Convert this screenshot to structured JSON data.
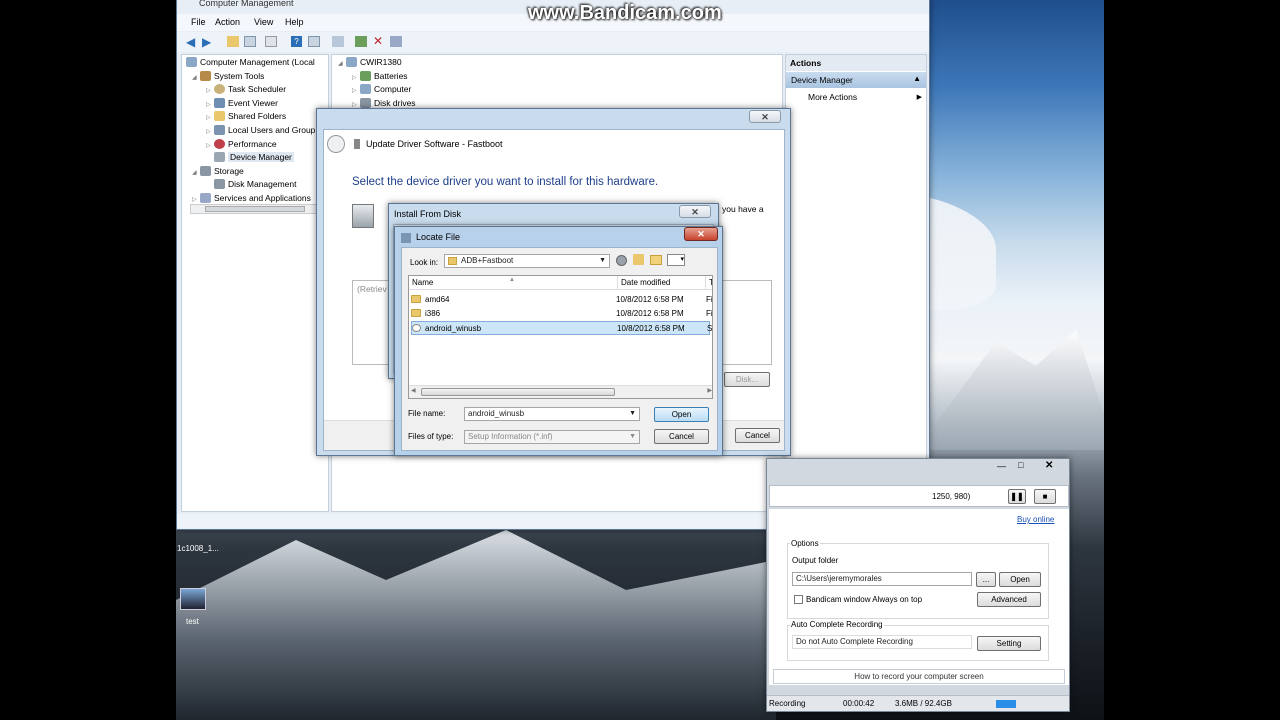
{
  "watermark": "www.Bandicam.com",
  "cm": {
    "title": "Computer Management",
    "menu": [
      "File",
      "Action",
      "View",
      "Help"
    ],
    "tree": [
      "Computer Management (Local",
      "System Tools",
      "Task Scheduler",
      "Event Viewer",
      "Shared Folders",
      "Local Users and Group",
      "Performance",
      "Device Manager",
      "Storage",
      "Disk Management",
      "Services and Applications"
    ],
    "devices": {
      "root": "CWIR1380",
      "items": [
        "Batteries",
        "Computer",
        "Disk drives"
      ]
    },
    "actions": {
      "header": "Actions",
      "section": "Device Manager",
      "more": "More Actions"
    }
  },
  "upd": {
    "title": "Update Driver Software - Fastboot",
    "heading": "Select the device driver you want to install for this hardware.",
    "partial": "you have a",
    "retrieving": "(Retriev",
    "disk_btn": "Disk...",
    "cancel": "Cancel"
  },
  "ifd": {
    "title": "Install From Disk"
  },
  "lf": {
    "title": "Locate File",
    "look_label": "Look in:",
    "look_value": "ADB+Fastboot",
    "cols": [
      "Name",
      "Date modified",
      "Ty"
    ],
    "files": [
      {
        "name": "amd64",
        "date": "10/8/2012 6:58 PM",
        "type": "Fi"
      },
      {
        "name": "i386",
        "date": "10/8/2012 6:58 PM",
        "type": "Fi"
      },
      {
        "name": "android_winusb",
        "date": "10/8/2012 6:58 PM",
        "type": "Se"
      }
    ],
    "fname_label": "File name:",
    "fname_value": "android_winusb",
    "ftype_label": "Files of type:",
    "ftype_value": "Setup Information (*.inf)",
    "open": "Open",
    "cancel": "Cancel"
  },
  "desktop": {
    "file_label": "1c1008_1...",
    "icon_label": "test"
  },
  "bc": {
    "coords": "1250, 980)",
    "buy": "Buy online",
    "options": "Options",
    "out_label": "Output folder",
    "out_value": "C:\\Users\\jeremymorales",
    "dots": "...",
    "open": "Open",
    "always_top": "Bandicam window Always on top",
    "advanced": "Advanced",
    "auto_label": "Auto Complete Recording",
    "auto_value": "Do not Auto Complete Recording",
    "setting": "Setting",
    "howto": "How to record your computer screen",
    "status": "Recording",
    "time": "00:00:42",
    "size": "3.6MB / 92.4GB"
  }
}
